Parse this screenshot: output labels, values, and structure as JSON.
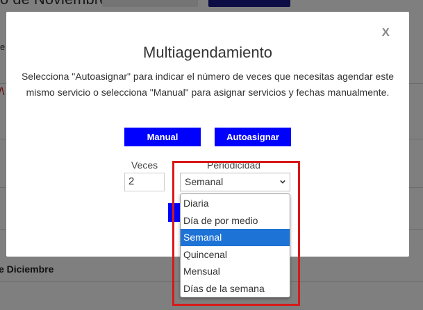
{
  "background": {
    "heading": "o de Noviembre",
    "side_letter": "e",
    "side_red": "/\\",
    "month": "e Diciembre"
  },
  "modal": {
    "close_label": "X",
    "title": "Multiagendamiento",
    "description": "Selecciona \"Autoasignar\" para indicar el número de veces que necesitas agendar este mismo servicio o selecciona \"Manual\" para asignar servicios y fechas manualmente.",
    "manual_label": "Manual",
    "autoasignar_label": "Autoasignar",
    "veces_label": "Veces",
    "veces_value": "2",
    "periodicidad_label": "Periodicidad",
    "periodicidad_selected": "Semanal",
    "options": [
      {
        "label": "Diaria"
      },
      {
        "label": "Día de por medio"
      },
      {
        "label": "Semanal"
      },
      {
        "label": "Quincenal"
      },
      {
        "label": "Mensual"
      },
      {
        "label": "Días de la semana"
      }
    ]
  },
  "colors": {
    "button": "#0000ff",
    "selected_option": "#1e73d6",
    "highlight_box": "#d81818"
  }
}
